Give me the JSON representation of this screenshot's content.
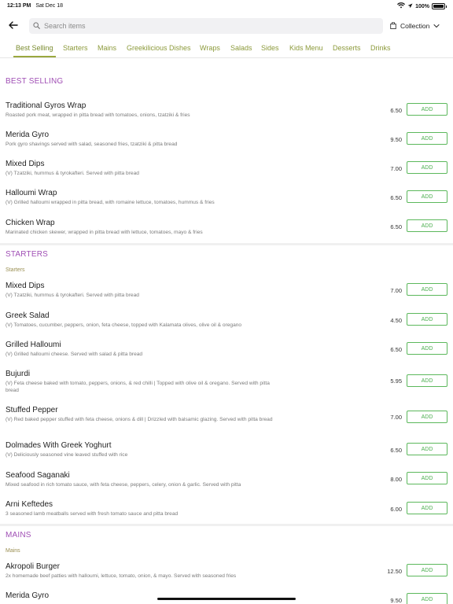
{
  "status_bar": {
    "time": "12:13 PM",
    "date": "Sat Dec 18",
    "battery_text": "100%",
    "battery_level": 1.0,
    "icons": [
      "wifi-icon",
      "location-icon",
      "battery-icon"
    ]
  },
  "header": {
    "back_icon": "arrow-left-icon",
    "search_placeholder": "Search items",
    "search_value": "",
    "collection_label": "Collection",
    "collection_icon": "bag-icon"
  },
  "tabs": [
    {
      "label": "Best Selling",
      "active": true
    },
    {
      "label": "Starters",
      "active": false
    },
    {
      "label": "Mains",
      "active": false
    },
    {
      "label": "Greekilicious Dishes",
      "active": false
    },
    {
      "label": "Wraps",
      "active": false
    },
    {
      "label": "Salads",
      "active": false
    },
    {
      "label": "Sides",
      "active": false
    },
    {
      "label": "Kids Menu",
      "active": false
    },
    {
      "label": "Desserts",
      "active": false
    },
    {
      "label": "Drinks",
      "active": false
    }
  ],
  "sections": [
    {
      "title": "BEST SELLING",
      "subtitle": "",
      "items": [
        {
          "name": "Traditional Gyros Wrap",
          "desc": "Roasted pork meat, wrapped in pitta bread with tomatoes, onions, tzatziki & fries",
          "price": "6.50",
          "add": "ADD"
        },
        {
          "name": "Merida Gyro",
          "desc": "Pork gyro shavings served with salad, seasoned fries, tzatziki & pitta bread",
          "price": "9.50",
          "add": "ADD"
        },
        {
          "name": "Mixed Dips",
          "desc": "(V) Tzatziki, hummus & tyrokafteri. Served with pitta bread",
          "price": "7.00",
          "add": "ADD"
        },
        {
          "name": "Halloumi Wrap",
          "desc": "(V) Grilled halloumi wrapped in pitta bread, with romaine lettuce, tomatoes, hummus & fries",
          "price": "6.50",
          "add": "ADD"
        },
        {
          "name": "Chicken Wrap",
          "desc": "Marinated chicken skewer, wrapped in pitta bread with lettuce, tomatoes, mayo & fries",
          "price": "6.50",
          "add": "ADD"
        }
      ]
    },
    {
      "title": "STARTERS",
      "subtitle": "Starters",
      "items": [
        {
          "name": "Mixed Dips",
          "desc": "(V) Tzatziki, hummus & tyrokafteri. Served with pitta bread",
          "price": "7.00",
          "add": "ADD"
        },
        {
          "name": "Greek Salad",
          "desc": "(V) Tomatoes, cucumber, peppers, onion, feta cheese, topped with Kalamata olives, olive oil & oregano",
          "price": "4.50",
          "add": "ADD"
        },
        {
          "name": "Grilled Halloumi",
          "desc": "(V) Grilled halloumi cheese. Served with salad & pitta bread",
          "price": "6.50",
          "add": "ADD"
        },
        {
          "name": "Bujurdi",
          "desc": "(V) Feta cheese baked with tomato, peppers, onions, & red chilli | Topped with olive oil & oregano. Served with pitta bread",
          "price": "5.95",
          "add": "ADD"
        },
        {
          "name": "Stuffed Pepper",
          "desc": "(V) Red baked pepper stuffed with feta cheese, onions & dill | Drizzled with balsamic glazing. Served with pitta bread",
          "price": "7.00",
          "add": "ADD"
        },
        {
          "name": "Dolmades With Greek Yoghurt",
          "desc": "(V) Deliciously seasoned vine leaved stuffed with rice",
          "price": "6.50",
          "add": "ADD"
        },
        {
          "name": "Seafood Saganaki",
          "desc": "Mixed seafood in rich tomato sauce, with feta cheese, peppers, celery, onion & garlic. Served with pitta",
          "price": "8.00",
          "add": "ADD"
        },
        {
          "name": "Arni Keftedes",
          "desc": "3 seasoned lamb meatballs served with fresh tomato sauce and pitta bread",
          "price": "6.00",
          "add": "ADD"
        }
      ]
    },
    {
      "title": "MAINS",
      "subtitle": "Mains",
      "items": [
        {
          "name": "Akropoli Burger",
          "desc": "2x homemade beef patties with halloumi, lettuce, tomato, onion, & mayo. Served with seasoned fries",
          "price": "12.50",
          "add": "ADD"
        },
        {
          "name": "Merida Gyro",
          "desc": "",
          "price": "9.50",
          "add": "ADD"
        }
      ]
    }
  ],
  "colors": {
    "section_title": "#a04fb5",
    "tab_text": "#8c9a3b",
    "add_button": "#4caf50"
  }
}
